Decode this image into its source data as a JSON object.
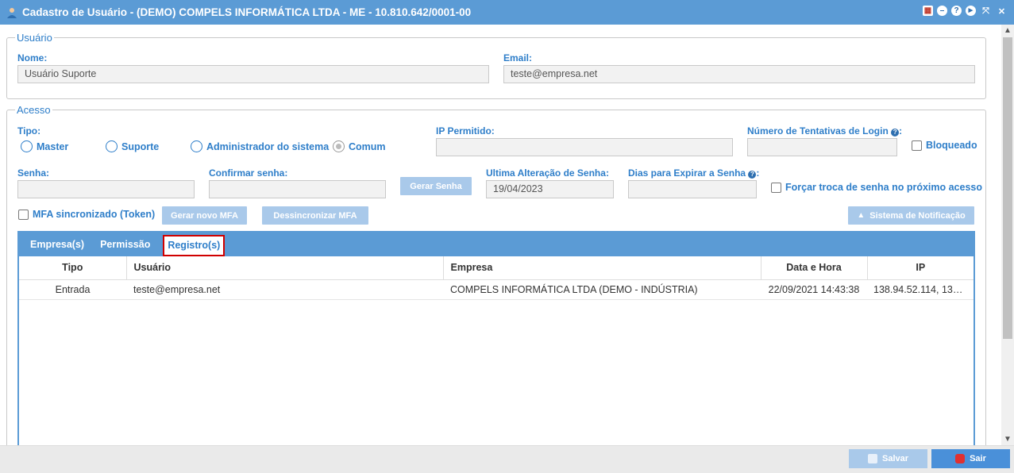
{
  "window": {
    "title": "Cadastro de Usuário - (DEMO) COMPELS INFORMÁTICA LTDA - ME - 10.810.642/0001-00",
    "tools": {
      "calendar": "▦",
      "minimize": "–",
      "help": "?",
      "play": "►",
      "resize": "⤧",
      "close": "✕"
    }
  },
  "usuario": {
    "legend": "Usuário",
    "nome_label": "Nome:",
    "nome_value": "Usuário Suporte",
    "email_label": "Email:",
    "email_value": "teste@empresa.net"
  },
  "acesso": {
    "legend": "Acesso",
    "tipo_label": "Tipo:",
    "tipo_options": [
      "Master",
      "Suporte",
      "Administrador do sistema",
      "Comum"
    ],
    "tipo_selected": "Comum",
    "ip_label": "IP Permitido:",
    "ip_value": "",
    "tentativas_label": "Número de Tentativas de Login",
    "tentativas_value": "",
    "bloqueado_label": "Bloqueado",
    "senha_label": "Senha:",
    "confirmar_label": "Confirmar senha:",
    "gerar_senha": "Gerar Senha",
    "ultima_alteracao_label": "Ultima Alteração de Senha:",
    "ultima_alteracao_value": "19/04/2023",
    "dias_expirar_label": "Dias para Expirar a Senha",
    "forcar_troca_label": "Forçar troca de senha no próximo acesso",
    "mfa_label": "MFA sincronizado (Token)",
    "gerar_mfa": "Gerar novo MFA",
    "dessincronizar_mfa": "Dessincronizar MFA",
    "sistema_notificacao": "Sistema de Notificação"
  },
  "tabs": [
    "Empresa(s)",
    "Permissão",
    "Registro(s)"
  ],
  "active_tab": "Registro(s)",
  "registros": {
    "columns": [
      "Tipo",
      "Usuário",
      "Empresa",
      "Data e Hora",
      "IP"
    ],
    "rows": [
      [
        "Entrada",
        "teste@empresa.net",
        "COMPELS INFORMÁTICA LTDA (DEMO - INDÚSTRIA)",
        "22/09/2021 14:43:38",
        "138.94.52.114, 13…"
      ]
    ]
  },
  "footer": {
    "salvar": "Salvar",
    "sair": "Sair"
  },
  "colors": {
    "titlebar": "#5b9bd5",
    "label": "#2e7ec9",
    "disabled_button": "#a9c9ea",
    "sair_button": "#4a90d9",
    "highlight": "#d00000"
  }
}
